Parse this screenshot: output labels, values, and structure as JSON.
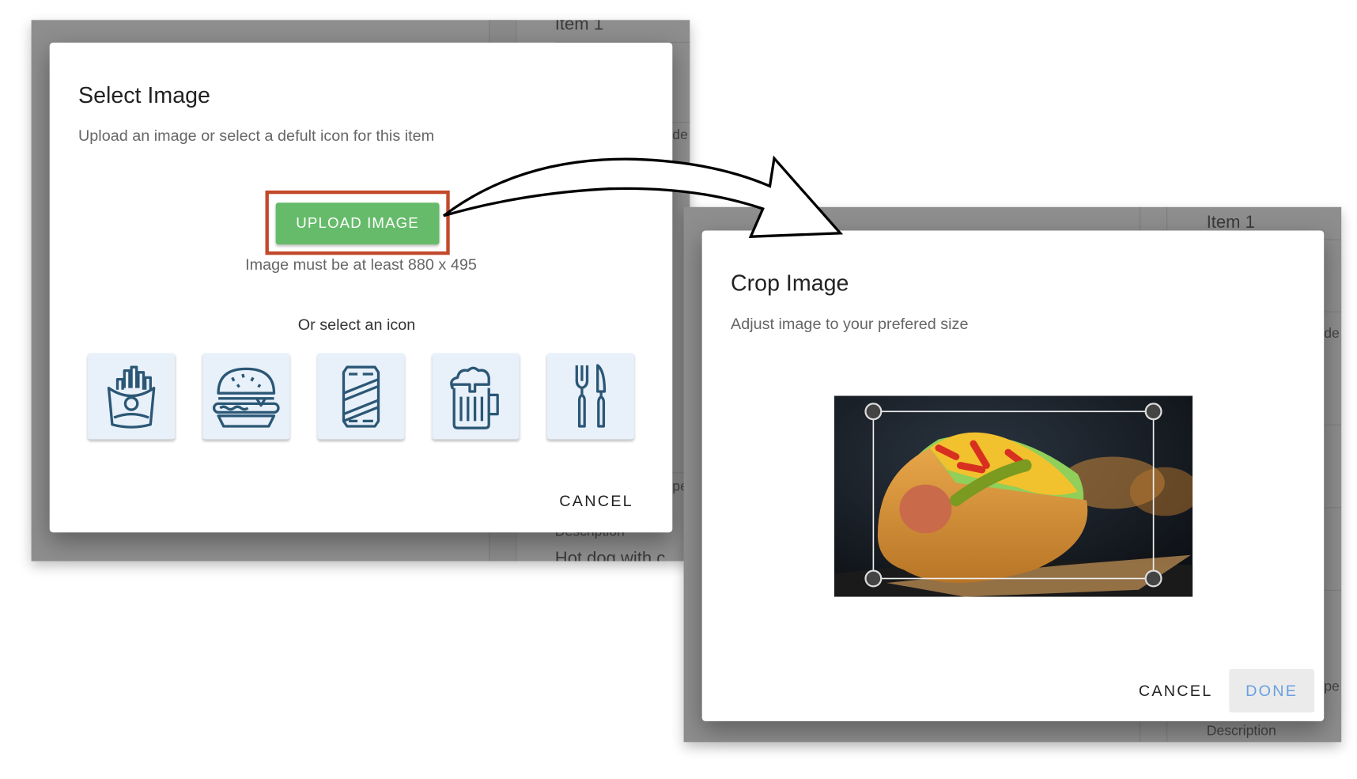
{
  "select_dialog": {
    "title": "Select Image",
    "subtitle": "Upload an image or select a defult icon for this item",
    "upload_label": "UPLOAD IMAGE",
    "hint": "Image must be at least 880 x 495",
    "or_label": "Or select an icon",
    "icons": [
      "fries-icon",
      "burger-icon",
      "soda-can-icon",
      "beer-mug-icon",
      "fork-knife-icon"
    ],
    "cancel_label": "CANCEL",
    "highlight_color": "#c2492b",
    "upload_color": "#66bb6a"
  },
  "crop_dialog": {
    "title": "Crop Image",
    "subtitle": "Adjust image to your prefered size",
    "cancel_label": "CANCEL",
    "done_label": "DONE"
  },
  "background_left": {
    "item": "Item 1",
    "frag1": "de",
    "frag2": "pe",
    "desc_label": "Description",
    "desc_value": "Hot dog with c"
  },
  "background_right": {
    "item": "Item 1",
    "frag1": "de",
    "frag2": "pe",
    "desc_label": "Description"
  },
  "icon_color": "#2b5775"
}
